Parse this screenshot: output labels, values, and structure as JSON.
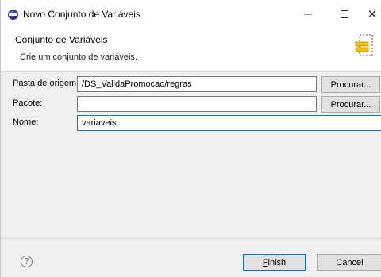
{
  "window": {
    "title": "Novo Conjunto de Variáveis",
    "close_glyph": "✕"
  },
  "banner": {
    "title": "Conjunto de Variáveis",
    "description": "Crie um conjunto de variáveis.",
    "icon": "variable-set-wizard-icon"
  },
  "form": {
    "source_folder": {
      "label": "Pasta de origem:",
      "value": "/DS_ValidaPromocao/regras",
      "button": "Procurar..."
    },
    "package": {
      "label": "Pacote:",
      "value": "",
      "button": "Procurar..."
    },
    "name": {
      "label": "Nome:",
      "value": "variaveis"
    }
  },
  "footer": {
    "help_glyph": "?",
    "finish_label_first": "F",
    "finish_label_rest": "inish",
    "cancel_label": "Cancel"
  },
  "colors": {
    "accent": "#0078d7",
    "icon_yellow": "#f2c200"
  }
}
